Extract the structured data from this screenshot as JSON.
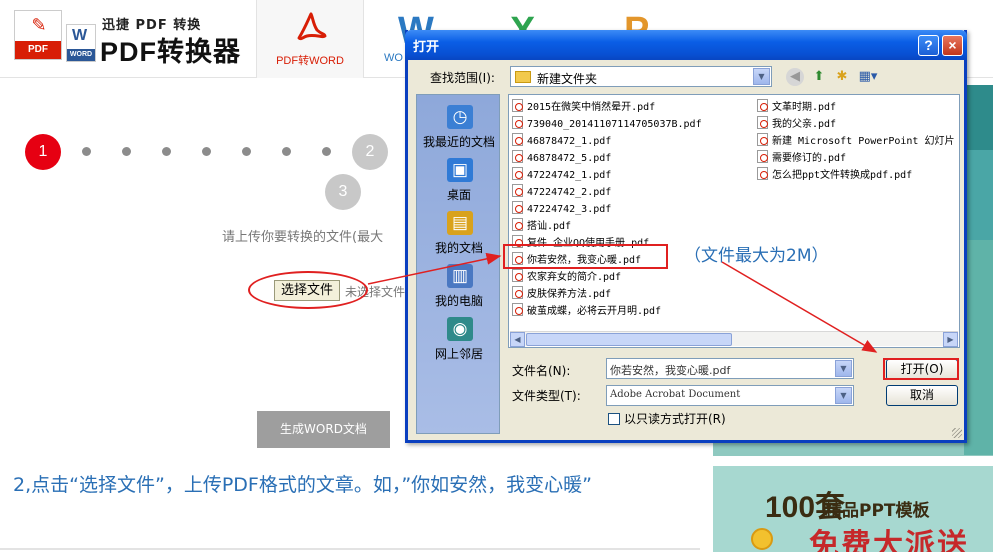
{
  "header": {
    "logo_sub": "迅捷 PDF 转换",
    "logo_main": "PDF转换器",
    "logo_pdf_text": "PDF",
    "logo_word_text": "WORD",
    "logo_word_letter": "W",
    "tab_active_label": "PDF转WORD",
    "tab_word_letter": "W",
    "tab_word_label": "WO",
    "tab_excel_letter": "X",
    "tab_ppt_letter": "P"
  },
  "steps": {
    "step1": "1",
    "step2": "2",
    "step3": "3"
  },
  "main": {
    "upload_hint": "请上传你要转换的文件(最大",
    "choose_file_button": "选择文件",
    "no_file_text": "未选择文件",
    "generate_button": "生成WORD文档",
    "instruction": "2,点击“选择文件”，上传PDF格式的文章。如，”你如安然，我变心暖”"
  },
  "promo": {
    "big": "100套",
    "small": "精品PPT模板",
    "sale": "免费大派送"
  },
  "dialog": {
    "title": "打开",
    "help_btn": "?",
    "close_btn": "×",
    "lookin_label": "查找范围(I):",
    "lookin_value": "新建文件夹",
    "places": [
      {
        "label": "我最近的文档",
        "icon": "recent-documents-icon",
        "glyph": "◷",
        "color": "#3b7fd4"
      },
      {
        "label": "桌面",
        "icon": "desktop-icon",
        "glyph": "▣",
        "color": "#2f7ad6"
      },
      {
        "label": "我的文档",
        "icon": "my-documents-icon",
        "glyph": "▤",
        "color": "#d9a21c"
      },
      {
        "label": "我的电脑",
        "icon": "my-computer-icon",
        "glyph": "▥",
        "color": "#4a78c2"
      },
      {
        "label": "网上邻居",
        "icon": "network-places-icon",
        "glyph": "◉",
        "color": "#2f8a8a"
      }
    ],
    "files_col1": [
      "2015在微笑中悄然晕开.pdf",
      "739040_20141107114705037B.pdf",
      "46878472_1.pdf",
      "46878472_5.pdf",
      "47224742_1.pdf",
      "47224742_2.pdf",
      "47224742_3.pdf",
      "搭讪.pdf",
      "复件 企业QQ使用手册.pdf",
      "你若安然，我变心暖.pdf",
      "农家弃女的简介.pdf",
      "皮肤保养方法.pdf",
      "破茧成蝶，必将云开月明.pdf"
    ],
    "files_col2": [
      "文革时期.pdf",
      "我的父亲.pdf",
      "新建 Microsoft PowerPoint 幻灯片",
      "需要修订的.pdf",
      "怎么把ppt文件转换成pdf.pdf"
    ],
    "filename_label": "文件名(N):",
    "filename_value": "你若安然，我变心暖.pdf",
    "filetype_label": "文件类型(T):",
    "filetype_value": "Adobe Acrobat Document",
    "readonly_label": "以只读方式打开(R)",
    "open_button": "打开(O)",
    "cancel_button": "取消"
  },
  "annotation": {
    "callout": "（文件最大为2M）"
  },
  "colors": {
    "accent_red": "#e60012",
    "link_blue": "#2a6fb5",
    "xp_title_blue": "#0a5ee6"
  }
}
